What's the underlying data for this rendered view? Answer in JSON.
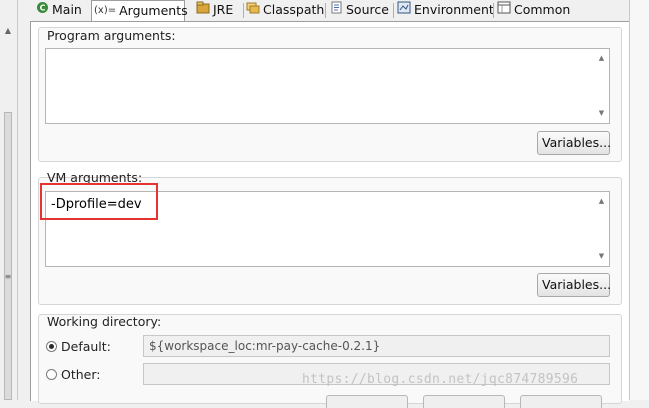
{
  "tabs": [
    {
      "label": "Main",
      "icon": "main-icon"
    },
    {
      "label": "Arguments",
      "icon": "arguments-icon",
      "active": true
    },
    {
      "label": "JRE",
      "icon": "jre-icon"
    },
    {
      "label": "Classpath",
      "icon": "classpath-icon"
    },
    {
      "label": "Source",
      "icon": "source-icon"
    },
    {
      "label": "Environment",
      "icon": "environment-icon"
    },
    {
      "label": "Common",
      "icon": "common-icon"
    }
  ],
  "program_args": {
    "label": "Program arguments:",
    "value": "",
    "variables_button": "Variables..."
  },
  "vm_args": {
    "label": "VM arguments:",
    "value": "-Dprofile=dev",
    "variables_button": "Variables..."
  },
  "working_dir": {
    "label": "Working directory:",
    "default_label": "Default:",
    "default_value": "${workspace_loc:mr-pay-cache-0.2.1}",
    "other_label": "Other:",
    "other_value": ""
  },
  "watermark": "https://blog.csdn.net/jqc874789596",
  "colors": {
    "highlight_box": "#e53232",
    "tab_border": "#9d9d9d"
  }
}
